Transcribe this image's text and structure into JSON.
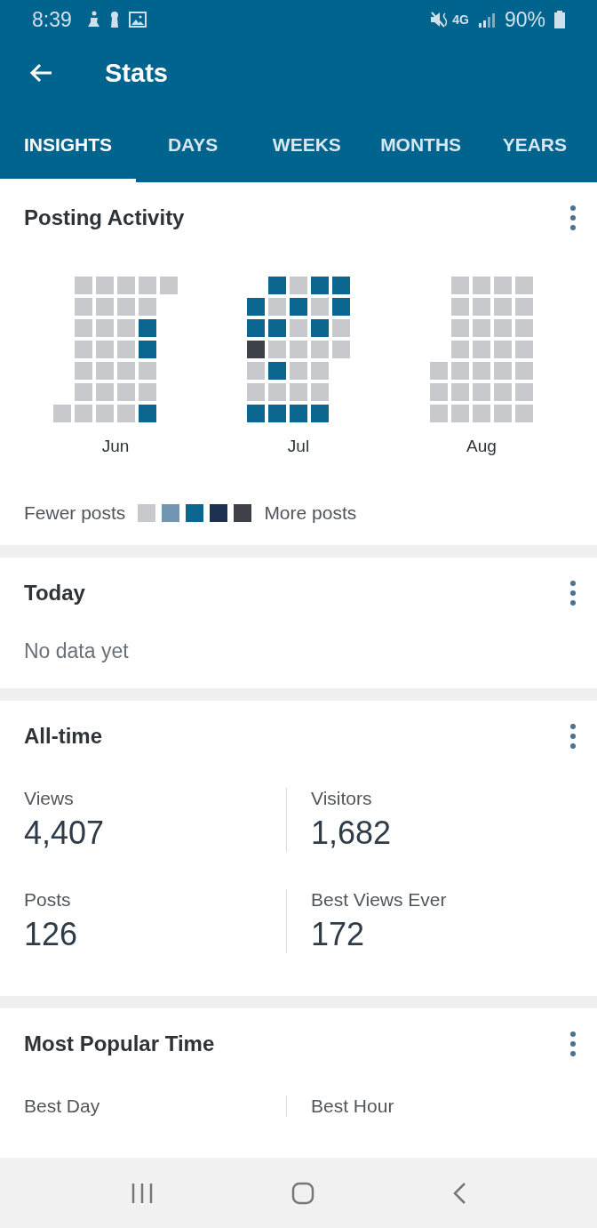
{
  "status_bar": {
    "time": "8:39",
    "network": "4G",
    "battery": "90%"
  },
  "app_bar": {
    "title": "Stats"
  },
  "tabs": [
    {
      "label": "INSIGHTS",
      "selected": true
    },
    {
      "label": "DAYS",
      "selected": false
    },
    {
      "label": "WEEKS",
      "selected": false
    },
    {
      "label": "MONTHS",
      "selected": false
    },
    {
      "label": "YEARS",
      "selected": false
    }
  ],
  "posting_activity": {
    "title": "Posting Activity",
    "months": [
      {
        "label": "Jun",
        "rows": [
          [
            null,
            {
              "color": "#c8c9cc"
            },
            {
              "color": "#c8c9cc"
            },
            {
              "color": "#c8c9cc"
            },
            {
              "color": "#c8c9cc"
            },
            {
              "color": "#c8c9cc"
            }
          ],
          [
            null,
            {
              "color": "#c8c9cc"
            },
            {
              "color": "#c8c9cc"
            },
            {
              "color": "#c8c9cc"
            },
            {
              "color": "#c8c9cc"
            },
            null
          ],
          [
            null,
            {
              "color": "#c8c9cc"
            },
            {
              "color": "#c8c9cc"
            },
            {
              "color": "#c8c9cc"
            },
            {
              "color": "#0b6690"
            },
            null
          ],
          [
            null,
            {
              "color": "#c8c9cc"
            },
            {
              "color": "#c8c9cc"
            },
            {
              "color": "#c8c9cc"
            },
            {
              "color": "#0b6690"
            },
            null
          ],
          [
            null,
            {
              "color": "#c8c9cc"
            },
            {
              "color": "#c8c9cc"
            },
            {
              "color": "#c8c9cc"
            },
            {
              "color": "#c8c9cc"
            },
            null
          ],
          [
            null,
            {
              "color": "#c8c9cc"
            },
            {
              "color": "#c8c9cc"
            },
            {
              "color": "#c8c9cc"
            },
            {
              "color": "#c8c9cc"
            },
            null
          ],
          [
            {
              "color": "#c8c9cc"
            },
            {
              "color": "#c8c9cc"
            },
            {
              "color": "#c8c9cc"
            },
            {
              "color": "#c8c9cc"
            },
            {
              "color": "#0b6690"
            },
            null
          ]
        ]
      },
      {
        "label": "Jul",
        "rows": [
          [
            null,
            {
              "color": "#0b6690"
            },
            {
              "color": "#c8c9cc"
            },
            {
              "color": "#0b6690"
            },
            {
              "color": "#0b6690"
            }
          ],
          [
            {
              "color": "#0b6690"
            },
            {
              "color": "#c8c9cc"
            },
            {
              "color": "#0b6690"
            },
            {
              "color": "#c8c9cc"
            },
            {
              "color": "#0b6690"
            }
          ],
          [
            {
              "color": "#0b6690"
            },
            {
              "color": "#0b6690"
            },
            {
              "color": "#c8c9cc"
            },
            {
              "color": "#0b6690"
            },
            {
              "color": "#c8c9cc"
            }
          ],
          [
            {
              "color": "#3e4147"
            },
            {
              "color": "#c8c9cc"
            },
            {
              "color": "#c8c9cc"
            },
            {
              "color": "#c8c9cc"
            },
            {
              "color": "#c8c9cc"
            }
          ],
          [
            {
              "color": "#c8c9cc"
            },
            {
              "color": "#0b6690"
            },
            {
              "color": "#c8c9cc"
            },
            {
              "color": "#c8c9cc"
            },
            null
          ],
          [
            {
              "color": "#c8c9cc"
            },
            {
              "color": "#c8c9cc"
            },
            {
              "color": "#c8c9cc"
            },
            {
              "color": "#c8c9cc"
            },
            null
          ],
          [
            {
              "color": "#0b6690"
            },
            {
              "color": "#0b6690"
            },
            {
              "color": "#0b6690"
            },
            {
              "color": "#0b6690"
            },
            null
          ]
        ]
      },
      {
        "label": "Aug",
        "rows": [
          [
            null,
            {
              "color": "#c8c9cc"
            },
            {
              "color": "#c8c9cc"
            },
            {
              "color": "#c8c9cc"
            },
            {
              "color": "#c8c9cc"
            }
          ],
          [
            null,
            {
              "color": "#c8c9cc"
            },
            {
              "color": "#c8c9cc"
            },
            {
              "color": "#c8c9cc"
            },
            {
              "color": "#c8c9cc"
            }
          ],
          [
            null,
            {
              "color": "#c8c9cc"
            },
            {
              "color": "#c8c9cc"
            },
            {
              "color": "#c8c9cc"
            },
            {
              "color": "#c8c9cc"
            }
          ],
          [
            null,
            {
              "color": "#c8c9cc"
            },
            {
              "color": "#c8c9cc"
            },
            {
              "color": "#c8c9cc"
            },
            {
              "color": "#c8c9cc"
            }
          ],
          [
            {
              "color": "#c8c9cc"
            },
            {
              "color": "#c8c9cc"
            },
            {
              "color": "#c8c9cc"
            },
            {
              "color": "#c8c9cc"
            },
            {
              "color": "#c8c9cc"
            }
          ],
          [
            {
              "color": "#c8c9cc"
            },
            {
              "color": "#c8c9cc"
            },
            {
              "color": "#c8c9cc"
            },
            {
              "color": "#c8c9cc"
            },
            {
              "color": "#c8c9cc"
            }
          ],
          [
            {
              "color": "#c8c9cc"
            },
            {
              "color": "#c8c9cc"
            },
            {
              "color": "#c8c9cc"
            },
            {
              "color": "#c8c9cc"
            },
            {
              "color": "#c8c9cc"
            }
          ]
        ]
      }
    ],
    "legend": {
      "fewer": "Fewer posts",
      "more": "More posts",
      "swatches": [
        {
          "color": "#c8c9cc"
        },
        {
          "color": "#7196b2"
        },
        {
          "color": "#0b6690"
        },
        {
          "color": "#1f3150"
        },
        {
          "color": "#3e4147"
        }
      ]
    }
  },
  "today": {
    "title": "Today",
    "message": "No data yet"
  },
  "all_time": {
    "title": "All-time",
    "stats": [
      {
        "label": "Views",
        "value": "4,407"
      },
      {
        "label": "Visitors",
        "value": "1,682"
      },
      {
        "label": "Posts",
        "value": "126"
      },
      {
        "label": "Best Views Ever",
        "value": "172"
      }
    ]
  },
  "most_popular_time": {
    "title": "Most Popular Time",
    "stats": [
      {
        "label": "Best Day"
      },
      {
        "label": "Best Hour"
      }
    ]
  }
}
